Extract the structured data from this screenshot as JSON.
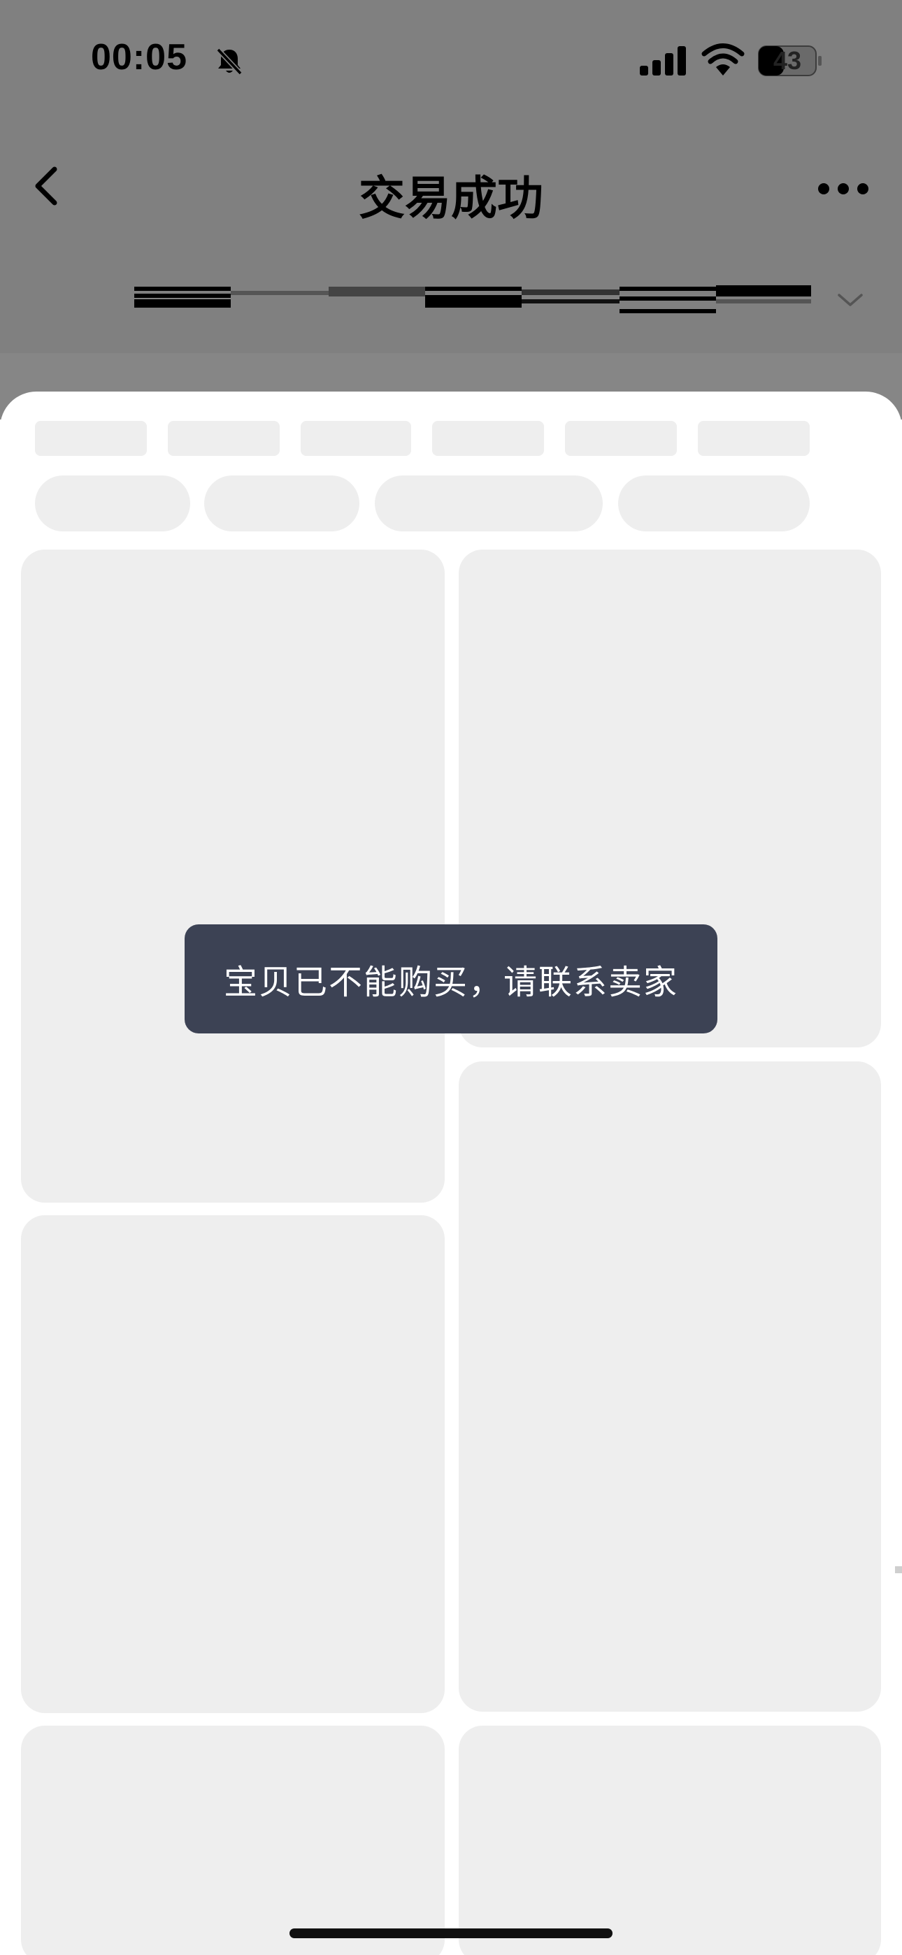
{
  "status_bar": {
    "time": "00:05",
    "battery": "43",
    "icons": [
      "bell-muted-icon",
      "signal-icon",
      "wifi-icon",
      "battery-icon"
    ]
  },
  "nav": {
    "title": "交易成功",
    "icons": [
      "back-icon",
      "more-icon",
      "chevron-down-icon"
    ]
  },
  "toast": {
    "message": "宝贝已不能购买，请联系卖家"
  },
  "colors": {
    "overlay": "#808080",
    "skeleton": "#eeeeee",
    "toast_bg": "#3c4254",
    "toast_text": "#ffffff"
  }
}
